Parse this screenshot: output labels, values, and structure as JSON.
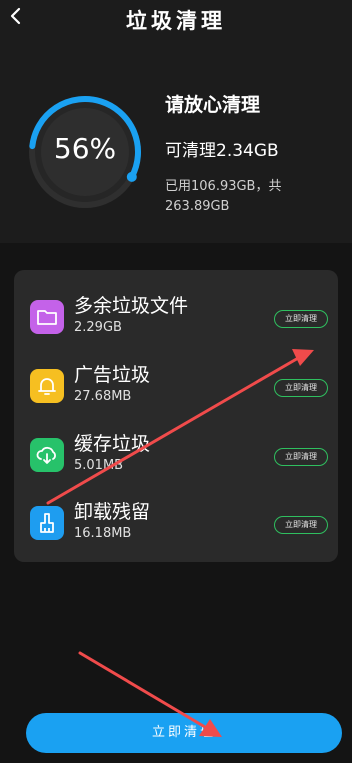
{
  "header": {
    "title": "垃圾清理"
  },
  "summary": {
    "percent_label": "56%",
    "percent_value": 56,
    "status_title": "请放心清理",
    "cleanable": "可清理2.34GB",
    "usage": "已用106.93GB，共263.89GB"
  },
  "items": [
    {
      "name": "多余垃圾文件",
      "size": "2.29GB",
      "button": "立即清理",
      "icon": "folder-icon",
      "color": "#c462e9"
    },
    {
      "name": "广告垃圾",
      "size": "27.68MB",
      "button": "立即清理",
      "icon": "bell-icon",
      "color": "#f6bf21"
    },
    {
      "name": "缓存垃圾",
      "size": "5.01MB",
      "button": "立即清理",
      "icon": "cloud-download-icon",
      "color": "#27c26a"
    },
    {
      "name": "卸载残留",
      "size": "16.18MB",
      "button": "立即清理",
      "icon": "brush-icon",
      "color": "#1e9df0"
    }
  ],
  "primary_button": "立即清理",
  "colors": {
    "accent": "#1aa1f2",
    "button_border": "#2fbf5f",
    "annotation": "#f04b4b"
  }
}
